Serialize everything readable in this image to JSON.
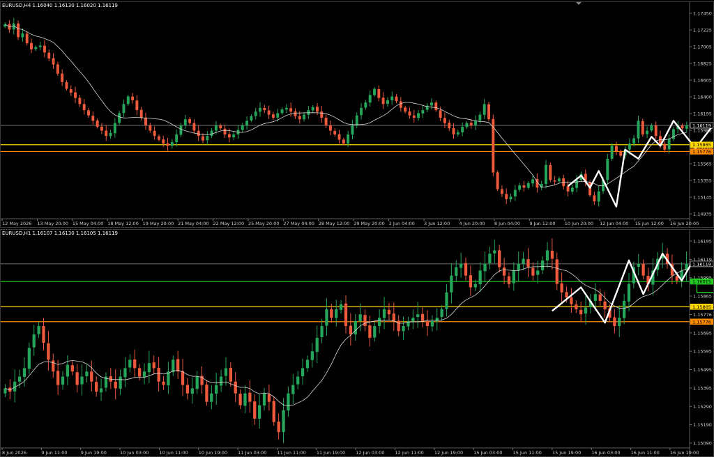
{
  "chart_data": [
    {
      "type": "candlestick",
      "title": "EURUSD,H4  1.16040 1.16130 1.16020 1.16119",
      "ylim": [
        1.149,
        1.1765
      ],
      "y_ticks": [
        "1.17450",
        "1.17225",
        "1.17005",
        "1.16825",
        "1.16605",
        "1.16400",
        "1.16195",
        "1.15985",
        "1.15776",
        "1.15565",
        "1.15355",
        "1.15145",
        "1.14935"
      ],
      "x_ticks": [
        "12 May 2026",
        "13 May 20:00",
        "15 May 04:00",
        "18 May 12:00",
        "19 May 20:00",
        "21 May 04:00",
        "22 May 12:00",
        "25 May 20:00",
        "27 May 04:00",
        "28 May 12:00",
        "29 May 20:00",
        "2 Jun 04:00",
        "3 Jun 12:00",
        "4 Jun 20:00",
        "8 Jun 04:00",
        "9 Jun 12:00",
        "10 Jun 20:00",
        "12 Jun 04:00",
        "15 Jun 12:00",
        "16 Jun 20:00"
      ],
      "price_tags": [
        {
          "value": 1.16119,
          "label": "1.16119",
          "color": "#ffffff"
        },
        {
          "value": 1.15865,
          "label": "1.15865",
          "color": "#ffd700"
        },
        {
          "value": 1.15776,
          "label": "1.15776",
          "color": "#ff8c00"
        }
      ],
      "hlines": [
        {
          "value": 1.16119,
          "color": "#9a9a9a"
        },
        {
          "value": 1.15865,
          "color": "#ffd700"
        },
        {
          "value": 1.15776,
          "color": "#ff8c00"
        }
      ],
      "close_path": [
        1.1745,
        1.1738,
        1.1746,
        1.1728,
        1.1733,
        1.172,
        1.1712,
        1.1715,
        1.1717,
        1.1708,
        1.17,
        1.1692,
        1.168,
        1.1669,
        1.166,
        1.1655,
        1.1648,
        1.164,
        1.1632,
        1.1625,
        1.1618,
        1.161,
        1.1605,
        1.1598,
        1.1602,
        1.1615,
        1.1628,
        1.164,
        1.165,
        1.1645,
        1.1632,
        1.1622,
        1.1612,
        1.1605,
        1.1598,
        1.1593,
        1.1588,
        1.1585,
        1.159,
        1.16,
        1.1612,
        1.162,
        1.1615,
        1.1605,
        1.1598,
        1.1592,
        1.1598,
        1.1605,
        1.1612,
        1.1608,
        1.16,
        1.1596,
        1.16,
        1.1606,
        1.1612,
        1.1618,
        1.1624,
        1.163,
        1.1635,
        1.1632,
        1.1626,
        1.1622,
        1.1628,
        1.1633,
        1.1635,
        1.163,
        1.1624,
        1.162,
        1.1626,
        1.1632,
        1.1636,
        1.163,
        1.1622,
        1.1612,
        1.1605,
        1.16,
        1.1593,
        1.1588,
        1.16,
        1.1612,
        1.1625,
        1.1635,
        1.1642,
        1.1652,
        1.166,
        1.1648,
        1.164,
        1.1645,
        1.165,
        1.1644,
        1.1635,
        1.163,
        1.1625,
        1.1622,
        1.1628,
        1.1632,
        1.1638,
        1.1642,
        1.1632,
        1.1622,
        1.1615,
        1.1608,
        1.16,
        1.1603,
        1.161,
        1.1615,
        1.1612,
        1.1618,
        1.1626,
        1.164,
        1.162,
        1.155,
        1.1528,
        1.1522,
        1.1515,
        1.1518,
        1.1527,
        1.1533,
        1.153,
        1.1536,
        1.1541,
        1.153,
        1.1535,
        1.156,
        1.154,
        1.1538,
        1.1542,
        1.1532,
        1.1525,
        1.153,
        1.154,
        1.1548,
        1.1537,
        1.152,
        1.1512,
        1.1525,
        1.154,
        1.1568,
        1.1585,
        1.1578,
        1.1572,
        1.158,
        1.1588,
        1.1595,
        1.1618,
        1.16,
        1.1605,
        1.1612,
        1.1598,
        1.1588,
        1.158,
        1.1594,
        1.1607,
        1.1612,
        1.1608,
        1.1612
      ],
      "zigzag": [
        {
          "i": 128,
          "v": 1.1532
        },
        {
          "i": 131,
          "v": 1.1546
        },
        {
          "i": 133,
          "v": 1.153
        },
        {
          "i": 135,
          "v": 1.1552
        },
        {
          "i": 139,
          "v": 1.1505
        },
        {
          "i": 141,
          "v": 1.158
        },
        {
          "i": 144,
          "v": 1.1568
        },
        {
          "i": 147,
          "v": 1.1597
        },
        {
          "i": 149,
          "v": 1.1585
        },
        {
          "i": 152,
          "v": 1.1618
        },
        {
          "i": 157,
          "v": 1.1582
        },
        {
          "i": 161,
          "v": 1.1612
        }
      ],
      "box": {
        "i0": 161,
        "i1": 171,
        "v0": 1.1576,
        "v1": 1.1567,
        "color": "#ff8c00"
      }
    },
    {
      "type": "candlestick",
      "title": "EURUSD,H1  1.16107 1.16130 1.16105 1.16119",
      "ylim": [
        1.1503,
        1.1628
      ],
      "y_ticks": [
        "1.16195",
        "1.16119",
        "1.15995",
        "1.15865",
        "1.15776",
        "1.15695",
        "1.15595",
        "1.15495",
        "1.15395",
        "1.15290",
        "1.15190",
        "1.15090"
      ],
      "x_ticks": [
        "8 Jun 2026",
        "9 Jun 11:00",
        "9 Jun 19:00",
        "10 Jun 03:00",
        "10 Jun 11:00",
        "10 Jun 19:00",
        "11 Jun 03:00",
        "11 Jun 11:00",
        "11 Jun 19:00",
        "12 Jun 03:00",
        "12 Jun 11:00",
        "12 Jun 19:00",
        "15 Jun 03:00",
        "15 Jun 11:00",
        "15 Jun 19:00",
        "16 Jun 03:00",
        "16 Jun 11:00",
        "16 Jun 19:00"
      ],
      "price_tags": [
        {
          "value": 1.16119,
          "label": "1.16119",
          "color": "#ffffff"
        },
        {
          "value": 1.16015,
          "label": "1.16015",
          "color": "#22cc22"
        },
        {
          "value": 1.15865,
          "label": "1.15865",
          "color": "#ffd700"
        },
        {
          "value": 1.15776,
          "label": "1.15776",
          "color": "#ff8c00"
        }
      ],
      "hlines": [
        {
          "value": 1.16119,
          "color": "#9a9a9a"
        },
        {
          "value": 1.16015,
          "color": "#22cc22"
        },
        {
          "value": 1.15865,
          "color": "#ffd700"
        },
        {
          "value": 1.15776,
          "color": "#ff8c00"
        }
      ],
      "close_path": [
        1.1538,
        1.1536,
        1.1542,
        1.1545,
        1.155,
        1.1562,
        1.157,
        1.1575,
        1.1565,
        1.1555,
        1.1548,
        1.154,
        1.1545,
        1.1552,
        1.1548,
        1.154,
        1.1545,
        1.1548,
        1.1542,
        1.1536,
        1.1538,
        1.1545,
        1.1542,
        1.1538,
        1.1545,
        1.155,
        1.1555,
        1.155,
        1.1545,
        1.1548,
        1.1553,
        1.155,
        1.1542,
        1.154,
        1.1548,
        1.1555,
        1.1548,
        1.154,
        1.1535,
        1.1538,
        1.1545,
        1.154,
        1.153,
        1.1535,
        1.154,
        1.1545,
        1.155,
        1.1542,
        1.1535,
        1.1528,
        1.1535,
        1.153,
        1.152,
        1.1528,
        1.1535,
        1.153,
        1.1518,
        1.1512,
        1.1525,
        1.1535,
        1.154,
        1.1545,
        1.155,
        1.1555,
        1.156,
        1.1568,
        1.1575,
        1.1585,
        1.158,
        1.1585,
        1.1588,
        1.1575,
        1.157,
        1.1578,
        1.1582,
        1.1575,
        1.1568,
        1.1575,
        1.158,
        1.1585,
        1.1582,
        1.1578,
        1.1572,
        1.1575,
        1.1578,
        1.158,
        1.1582,
        1.1578,
        1.1575,
        1.1578,
        1.158,
        1.1585,
        1.1595,
        1.1605,
        1.161,
        1.1612,
        1.1605,
        1.1598,
        1.16,
        1.1608,
        1.1612,
        1.1618,
        1.162,
        1.161,
        1.1605,
        1.16,
        1.1608,
        1.1612,
        1.1615,
        1.161,
        1.1605,
        1.1608,
        1.1614,
        1.162,
        1.1615,
        1.16,
        1.1595,
        1.1592,
        1.1588,
        1.1585,
        1.1582,
        1.1586,
        1.159,
        1.1594,
        1.159,
        1.1585,
        1.158,
        1.1575,
        1.158,
        1.159,
        1.16,
        1.161,
        1.1612,
        1.1605,
        1.16,
        1.1608,
        1.1615,
        1.1618,
        1.1612,
        1.1605,
        1.1602,
        1.1608,
        1.1612
      ],
      "zigzag": [
        {
          "i": 114,
          "v": 1.1584
        },
        {
          "i": 120,
          "v": 1.1598
        },
        {
          "i": 125,
          "v": 1.1577
        },
        {
          "i": 130,
          "v": 1.1614
        },
        {
          "i": 133,
          "v": 1.1594
        },
        {
          "i": 137,
          "v": 1.1618
        },
        {
          "i": 141,
          "v": 1.1602
        },
        {
          "i": 143,
          "v": 1.1612
        }
      ],
      "box": {
        "i0": 143,
        "i1": 153,
        "v0": 1.16,
        "v1": 1.1595,
        "color": "#22cc22"
      }
    }
  ]
}
